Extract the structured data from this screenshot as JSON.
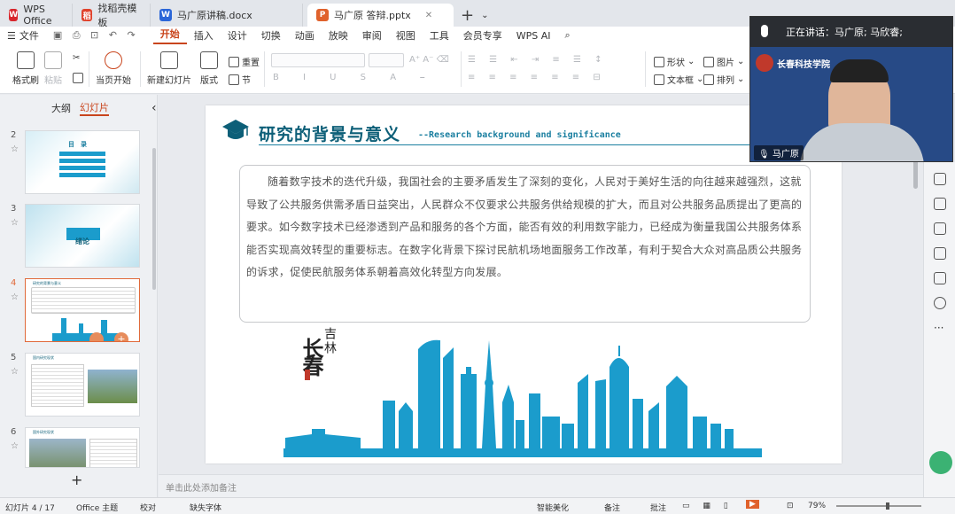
{
  "tabs": [
    {
      "label": "WPS Office",
      "icon": "wps-logo-icon",
      "color": "#d8262c"
    },
    {
      "label": "找稻壳模板",
      "icon": "docer-icon",
      "color": "#e0422c"
    },
    {
      "label": "马广原讲稿.docx",
      "icon": "word-doc-icon",
      "color": "#2b66d8"
    },
    {
      "label": "马广原 答辩.pptx",
      "icon": "ppt-doc-icon",
      "color": "#e0622c"
    }
  ],
  "menu": {
    "file": "文件",
    "items": [
      "开始",
      "插入",
      "设计",
      "切换",
      "动画",
      "放映",
      "审阅",
      "视图",
      "工具",
      "会员专享",
      "WPS AI"
    ]
  },
  "ribbon": {
    "format_painter": "格式刷",
    "paste": "粘贴",
    "play_from_current": "当页开始",
    "new_slide": "新建幻灯片",
    "layout": "版式",
    "reset": "重置",
    "section": "节",
    "shape": "形状",
    "picture": "图片",
    "textbox": "文本框",
    "arrange": "排列"
  },
  "left_panel": {
    "tab_outline": "大纲",
    "tab_slides": "幻灯片",
    "thumbs": [
      {
        "num": "2",
        "title": "目　录"
      },
      {
        "num": "3",
        "title": "绪论"
      },
      {
        "num": "4",
        "title": "研究的背景与意义"
      },
      {
        "num": "5",
        "title": "国内研究现状"
      },
      {
        "num": "6",
        "title": "国外研究现状"
      }
    ]
  },
  "slide": {
    "title": "研究的背景与意义",
    "subtitle": "--Research background and significance",
    "body": "随着数字技术的迭代升级，我国社会的主要矛盾发生了深刻的变化，人民对于美好生活的向往越来越强烈，这就导致了公共服务供需矛盾日益突出，人民群众不仅要求公共服务供给规模的扩大，而且对公共服务品质提出了更高的要求。如今数字技术已经渗透到产品和服务的各个方面，能否有效的利用数字能力，已经成为衡量我国公共服务体系能否实现高效转型的重要标志。在数字化背景下探讨民航机场地面服务工作改革，有利于契合大众对高品质公共服务的诉求，促使民航服务体系朝着高效化转型方向发展。",
    "city_cn": "吉林",
    "city_big": "长春",
    "accent": "#0d5f78",
    "skyline": "#1b9ccc"
  },
  "notes_placeholder": "单击此处添加备注",
  "video": {
    "speaking": "正在讲话：马广原; 马欣睿;",
    "name": "马广原",
    "school": "长春科技学院"
  },
  "status": {
    "slide_count": "幻灯片 4 / 17",
    "theme": "Office 主题",
    "proof": "校对",
    "missing_font": "缺失字体",
    "beautify": "智能美化",
    "notes": "备注",
    "comments": "批注",
    "zoom": "79%"
  }
}
